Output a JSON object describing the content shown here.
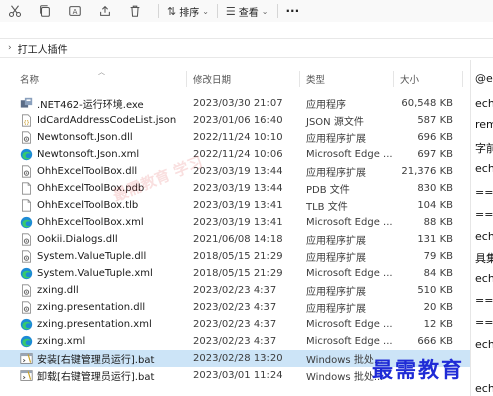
{
  "toolbar": {
    "sort_label": "排序",
    "view_label": "查看",
    "more_label": "···"
  },
  "address": {
    "crumb": "打工人插件"
  },
  "columns": {
    "name": "名称",
    "date": "修改日期",
    "type": "类型",
    "size": "大小"
  },
  "files": [
    {
      "name": ".NET462-运行环境.exe",
      "date": "2023/03/30 21:07",
      "type": "应用程序",
      "size": "60,548 KB",
      "icon": "exe-icon"
    },
    {
      "name": "IdCardAddressCodeList.json",
      "date": "2023/01/06 16:40",
      "type": "JSON 源文件",
      "size": "587 KB",
      "icon": "json-icon"
    },
    {
      "name": "Newtonsoft.Json.dll",
      "date": "2022/11/24 10:10",
      "type": "应用程序扩展",
      "size": "696 KB",
      "icon": "dll-icon"
    },
    {
      "name": "Newtonsoft.Json.xml",
      "date": "2022/11/24 10:06",
      "type": "Microsoft Edge ...",
      "size": "697 KB",
      "icon": "edge-icon"
    },
    {
      "name": "OhhExcelToolBox.dll",
      "date": "2023/03/19 13:44",
      "type": "应用程序扩展",
      "size": "21,376 KB",
      "icon": "dll-icon"
    },
    {
      "name": "OhhExcelToolBox.pdb",
      "date": "2023/03/19 13:44",
      "type": "PDB 文件",
      "size": "830 KB",
      "icon": "file-icon"
    },
    {
      "name": "OhhExcelToolBox.tlb",
      "date": "2023/03/19 13:41",
      "type": "TLB 文件",
      "size": "104 KB",
      "icon": "file-icon"
    },
    {
      "name": "OhhExcelToolBox.xml",
      "date": "2023/03/19 13:41",
      "type": "Microsoft Edge ...",
      "size": "88 KB",
      "icon": "edge-icon"
    },
    {
      "name": "Ookii.Dialogs.dll",
      "date": "2021/06/08 14:18",
      "type": "应用程序扩展",
      "size": "131 KB",
      "icon": "dll-icon"
    },
    {
      "name": "System.ValueTuple.dll",
      "date": "2018/05/15 21:29",
      "type": "应用程序扩展",
      "size": "79 KB",
      "icon": "dll-icon"
    },
    {
      "name": "System.ValueTuple.xml",
      "date": "2018/05/15 21:29",
      "type": "Microsoft Edge ...",
      "size": "84 KB",
      "icon": "edge-icon"
    },
    {
      "name": "zxing.dll",
      "date": "2023/02/23 4:37",
      "type": "应用程序扩展",
      "size": "510 KB",
      "icon": "dll-icon"
    },
    {
      "name": "zxing.presentation.dll",
      "date": "2023/02/23 4:37",
      "type": "应用程序扩展",
      "size": "20 KB",
      "icon": "dll-icon"
    },
    {
      "name": "zxing.presentation.xml",
      "date": "2023/02/23 4:37",
      "type": "Microsoft Edge ...",
      "size": "12 KB",
      "icon": "edge-icon"
    },
    {
      "name": "zxing.xml",
      "date": "2023/02/23 4:37",
      "type": "Microsoft Edge ...",
      "size": "666 KB",
      "icon": "edge-icon"
    },
    {
      "name": "安装[右键管理员运行].bat",
      "date": "2023/02/28 13:20",
      "type": "Windows 批处...",
      "size": "",
      "icon": "bat-icon",
      "selected": true
    },
    {
      "name": "卸载[右键管理员运行].bat",
      "date": "2023/03/01 11:24",
      "type": "Windows 批处...",
      "size": "",
      "icon": "bat-icon"
    }
  ],
  "right_pane": [
    "@e",
    "ech",
    "rem",
    "字前",
    "ech",
    "==:",
    "==:",
    "ech",
    "具集",
    "ech",
    "==:",
    "==:",
    "ech",
    "ech"
  ],
  "watermark": "最需教育",
  "faint_watermark": "最需教育 学习"
}
